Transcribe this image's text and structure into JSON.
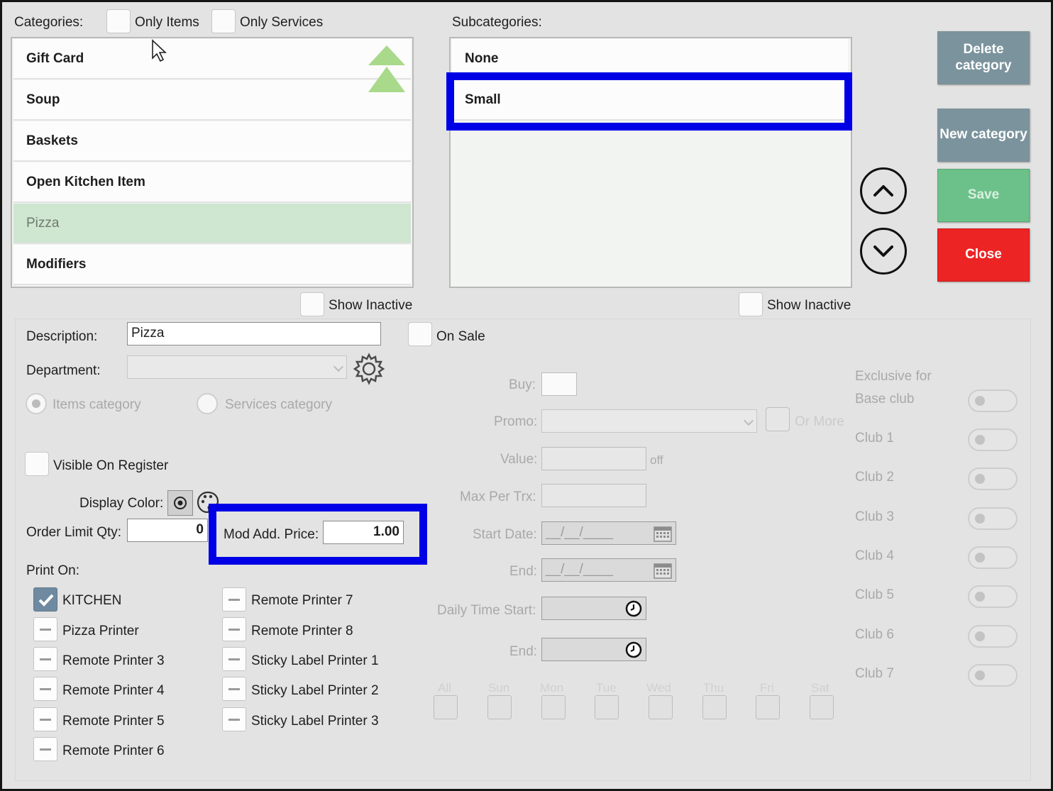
{
  "categories": {
    "label": "Categories:",
    "only_items": "Only Items",
    "only_services": "Only Services",
    "items": [
      "Gift Card",
      "Soup",
      "Baskets",
      "Open Kitchen Item",
      "Pizza",
      "Modifiers"
    ],
    "selected": "Pizza",
    "show_inactive": "Show Inactive"
  },
  "subcategories": {
    "label": "Subcategories:",
    "items": [
      "None",
      "Small"
    ],
    "selected": "Small",
    "show_inactive": "Show Inactive"
  },
  "actions": {
    "delete": "Delete category",
    "new": "New category",
    "save": "Save",
    "close": "Close"
  },
  "form": {
    "description_label": "Description:",
    "description_value": "Pizza",
    "on_sale": "On Sale",
    "department_label": "Department:",
    "department_value": "",
    "items_category": "Items category",
    "services_category": "Services category",
    "visible_on_register": "Visible On Register",
    "display_color": "Display Color:",
    "order_limit_label": "Order Limit Qty:",
    "order_limit_value": "0",
    "mod_add_price_label": "Mod Add. Price:",
    "mod_add_price_value": "1.00",
    "print_on": "Print On:"
  },
  "printers": {
    "left": [
      {
        "name": "KITCHEN",
        "checked": true
      },
      {
        "name": "Pizza Printer",
        "checked": false
      },
      {
        "name": "Remote Printer 3",
        "checked": false
      },
      {
        "name": "Remote Printer 4",
        "checked": false
      },
      {
        "name": "Remote Printer 5",
        "checked": false
      },
      {
        "name": "Remote Printer 6",
        "checked": false
      }
    ],
    "right": [
      {
        "name": "Remote Printer 7",
        "checked": false
      },
      {
        "name": "Remote Printer 8",
        "checked": false
      },
      {
        "name": "Sticky Label Printer 1",
        "checked": false
      },
      {
        "name": "Sticky Label Printer 2",
        "checked": false
      },
      {
        "name": "Sticky Label Printer 3",
        "checked": false
      }
    ]
  },
  "promo": {
    "buy": "Buy:",
    "promo": "Promo:",
    "or_more": "Or More",
    "value": "Value:",
    "off": "off",
    "max_per_trx": "Max Per Trx:",
    "start_date": "Start Date:",
    "start_date_value": "__/__/____",
    "end": "End:",
    "end_date_value": "__/__/____",
    "daily_time_start": "Daily Time Start:",
    "daily_end": "End:",
    "days": [
      "All",
      "Sun",
      "Mon",
      "Tue",
      "Wed",
      "Thu",
      "Fri",
      "Sat"
    ]
  },
  "clubs": {
    "exclusive_for": "Exclusive for",
    "items": [
      "Base club",
      "Club 1",
      "Club 2",
      "Club 3",
      "Club 4",
      "Club 5",
      "Club 6",
      "Club 7"
    ]
  },
  "colors": {
    "highlight": "#0000e6",
    "selected_row": "#cfe6d1",
    "save": "#6cc18a",
    "close": "#ec2424",
    "gray_button": "#7b939c"
  }
}
